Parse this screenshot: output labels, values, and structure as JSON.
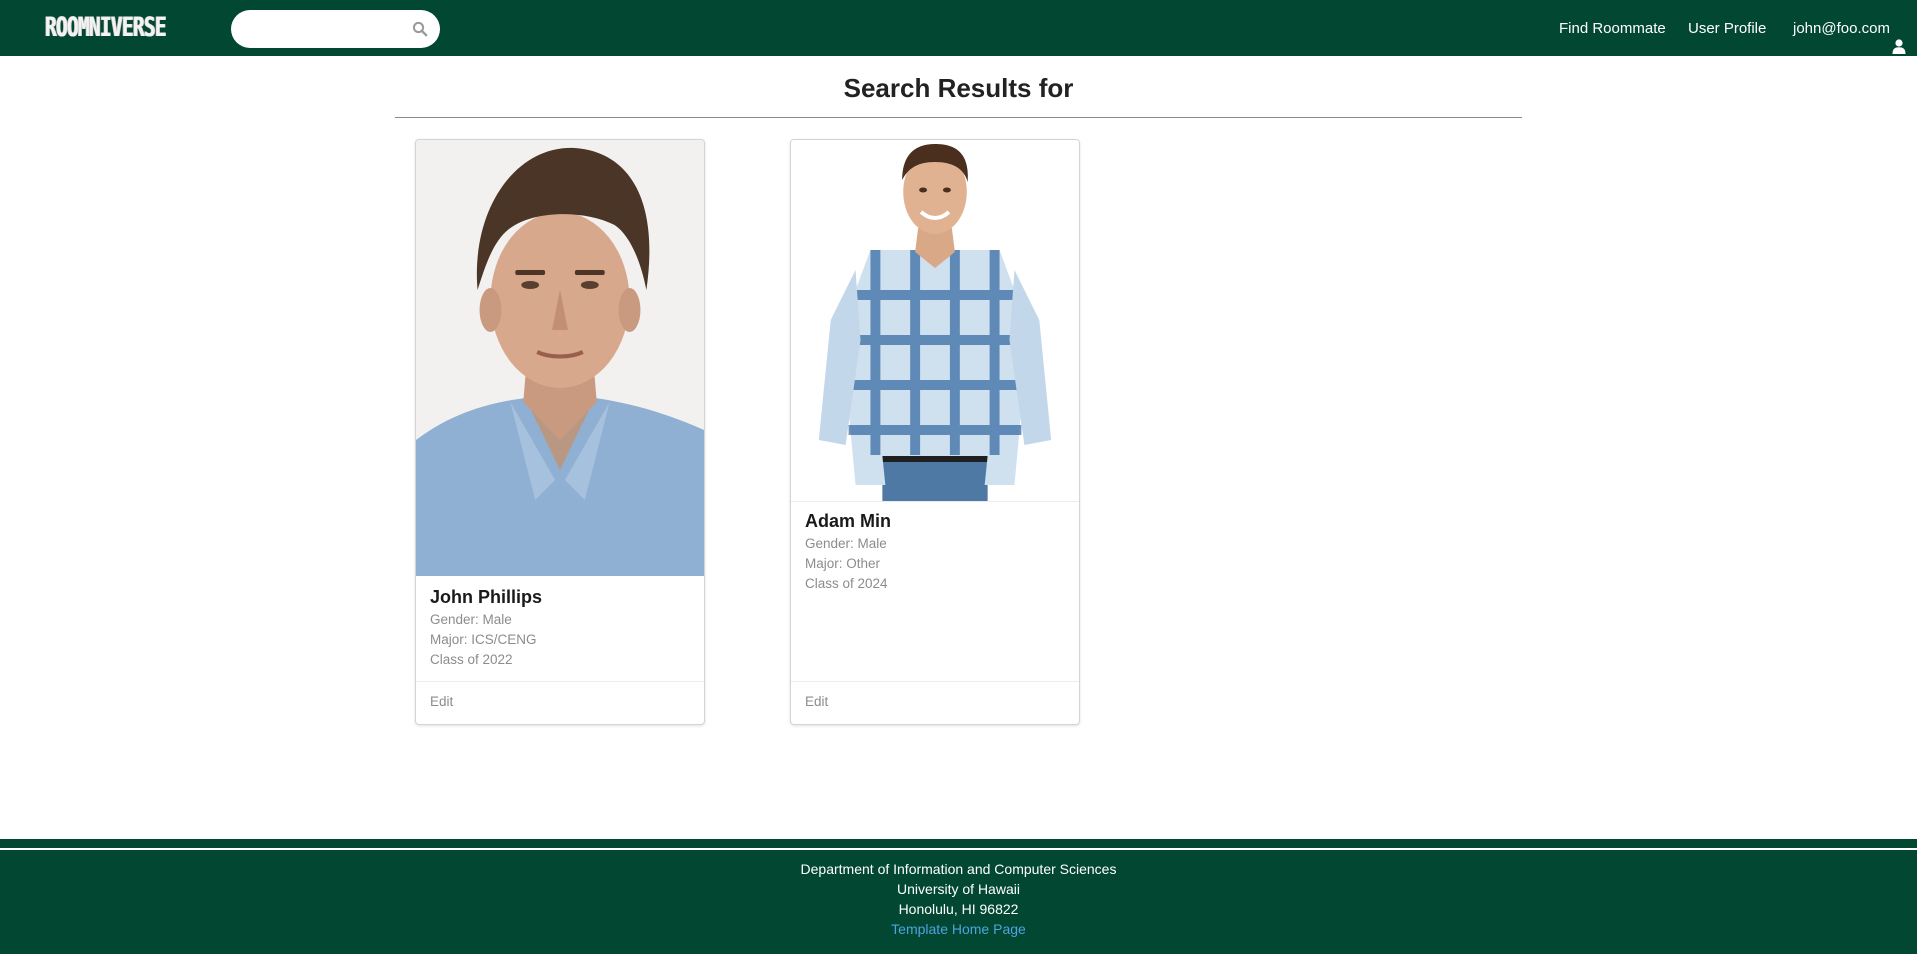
{
  "navbar": {
    "brand": "ROOMNIVERSE",
    "search": {
      "value": "",
      "placeholder": ""
    },
    "links": {
      "find_roommate": "Find Roommate",
      "user_profile": "User Profile"
    },
    "user_email": "john@foo.com",
    "colors": {
      "background": "#024731",
      "text": "#ffffff"
    }
  },
  "page": {
    "title": "Search Results for"
  },
  "results": [
    {
      "name": "John Phillips",
      "gender": "Gender: Male",
      "major": "Major: ICS/CENG",
      "class_year": "Class of 2022",
      "edit_label": "Edit",
      "image": "portrait-photo"
    },
    {
      "name": "Adam Min",
      "gender": "Gender: Male",
      "major": "Major: Other",
      "class_year": "Class of 2024",
      "edit_label": "Edit",
      "image": "full-body-photo"
    }
  ],
  "footer": {
    "lines": [
      "Department of Information and Computer Sciences",
      "University of Hawaii",
      "Honolulu, HI 96822"
    ],
    "link_label": "Template Home Page",
    "colors": {
      "background": "#024731",
      "link": "#4ea3e0"
    }
  }
}
